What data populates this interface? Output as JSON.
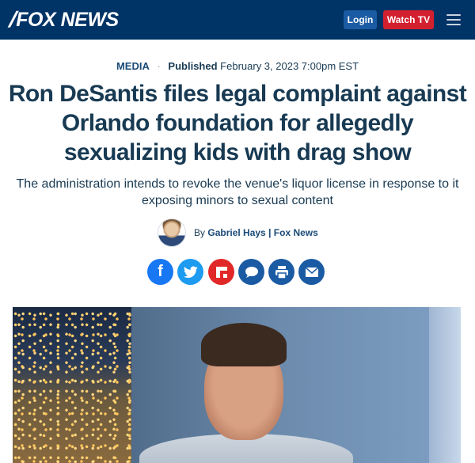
{
  "header": {
    "logo": "FOX NEWS",
    "login_label": "Login",
    "watch_label": "Watch TV"
  },
  "article": {
    "category": "MEDIA",
    "published_label": "Published",
    "published_date": "February 3, 2023 7:00pm EST",
    "headline": "Ron DeSantis files legal complaint against Orlando foundation for allegedly sexualizing kids with drag show",
    "subhead": "The administration intends to revoke the venue's liquor license in response to it exposing minors to sexual content",
    "byline_prefix": "By",
    "author": "Gabriel Hays",
    "byline_separator": "|",
    "outlet": "Fox News"
  },
  "share": {
    "facebook_glyph": "f",
    "icons": [
      "facebook-icon",
      "twitter-icon",
      "flipboard-icon",
      "comment-icon",
      "print-icon",
      "email-icon"
    ]
  },
  "colors": {
    "brand_navy": "#003366",
    "login_blue": "#1a5ba3",
    "watch_red": "#d3202f",
    "facebook": "#1877f2",
    "twitter": "#1d9bf0",
    "flipboard": "#e12828"
  }
}
